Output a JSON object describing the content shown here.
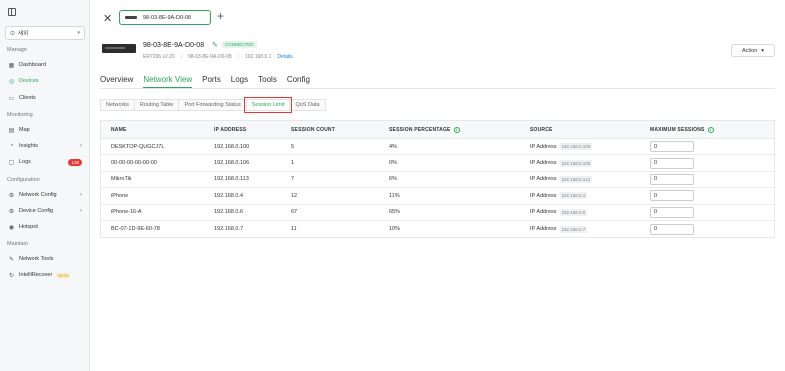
{
  "sidebar": {
    "site": "새위",
    "sections": [
      {
        "title": "Manage",
        "items": [
          {
            "label": "Dashboard",
            "icon": "dashboard-icon"
          },
          {
            "label": "Devices",
            "icon": "devices-icon",
            "active": true
          },
          {
            "label": "Clients",
            "icon": "clients-icon"
          }
        ]
      },
      {
        "title": "Monitoring",
        "items": [
          {
            "label": "Map",
            "icon": "map-icon"
          },
          {
            "label": "Insights",
            "icon": "insights-icon"
          },
          {
            "label": "Logs",
            "icon": "logs-icon",
            "badge": "136"
          }
        ]
      },
      {
        "title": "Configuration",
        "items": [
          {
            "label": "Network Config",
            "icon": "network-config-icon"
          },
          {
            "label": "Device Config",
            "icon": "device-config-icon"
          },
          {
            "label": "Hotspot",
            "icon": "hotspot-icon"
          }
        ]
      },
      {
        "title": "Maintain",
        "items": [
          {
            "label": "Network Tools",
            "icon": "network-tools-icon"
          },
          {
            "label": "IntelliRecover",
            "icon": "intellirecover-icon",
            "beta": "BETA"
          }
        ]
      }
    ]
  },
  "tabbar": {
    "device_tab": "98-03-8E-9A-D0-08"
  },
  "device": {
    "name": "98-03-8E-9A-D0-08",
    "status": "CONNECTED",
    "model": "ER7206 v2.20",
    "mac": "98-03-8E-9A-D0-08",
    "ip": "192.168.0.1",
    "details_link": "Details",
    "action_label": "Action"
  },
  "main_tabs": [
    "Overview",
    "Network View",
    "Ports",
    "Logs",
    "Tools",
    "Config"
  ],
  "sub_tabs": [
    "Networks",
    "Routing Table",
    "Port Forwarding Status",
    "Session Limit",
    "QoS Data"
  ],
  "table": {
    "headers": [
      "NAME",
      "IP ADDRESS",
      "SESSION COUNT",
      "SESSION PERCENTAGE",
      "SOURCE",
      "MAXIMUM SESSIONS"
    ],
    "rows": [
      {
        "name": "DESKTOP-QUGCJ7L",
        "ip": "192.168.0.100",
        "count": "5",
        "pct": "4%",
        "source": "IP Address",
        "chip": "192.168.0.100",
        "max": "0"
      },
      {
        "name": "00-00-00-00-00-00",
        "ip": "192.168.0.106",
        "count": "1",
        "pct": "0%",
        "source": "IP Address",
        "chip": "192.168.0.106",
        "max": "0"
      },
      {
        "name": "MikroTik",
        "ip": "192.168.0.113",
        "count": "7",
        "pct": "6%",
        "source": "IP Address",
        "chip": "192.168.0.113",
        "max": "0"
      },
      {
        "name": "iPhone",
        "ip": "192.168.0.4",
        "count": "12",
        "pct": "11%",
        "source": "IP Address",
        "chip": "192.168.0.4",
        "max": "0"
      },
      {
        "name": "iPhone-16-A",
        "ip": "192.168.0.6",
        "count": "67",
        "pct": "65%",
        "source": "IP Address",
        "chip": "192.168.0.6",
        "max": "0"
      },
      {
        "name": "BC-07-1D-9E-60-78",
        "ip": "192.168.0.7",
        "count": "11",
        "pct": "10%",
        "source": "IP Address",
        "chip": "192.168.0.7",
        "max": "0"
      }
    ]
  }
}
